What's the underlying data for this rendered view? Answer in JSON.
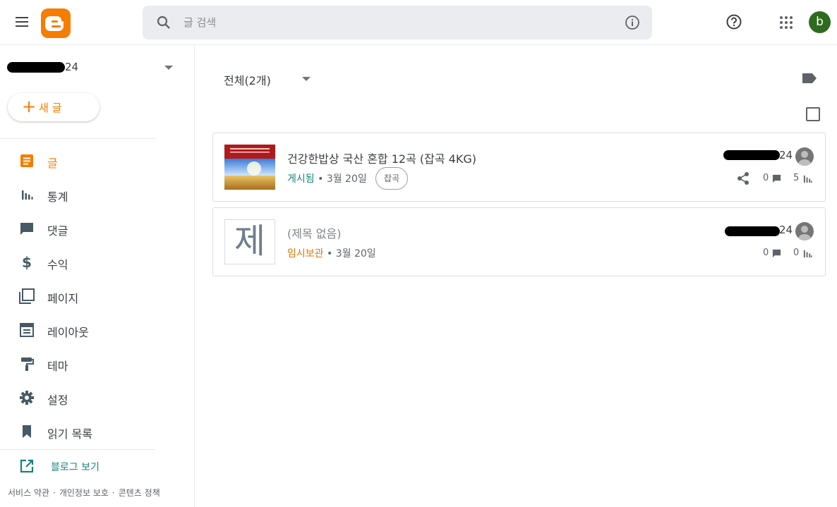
{
  "header": {
    "search_placeholder": "글 검색",
    "avatar_letter": "b"
  },
  "sidebar": {
    "blog_name_suffix": "24",
    "new_post_label": "새 글",
    "nav": [
      {
        "label": "글",
        "icon": "posts-icon",
        "active": true
      },
      {
        "label": "통계",
        "icon": "stats-icon",
        "active": false
      },
      {
        "label": "댓글",
        "icon": "comment-icon",
        "active": false
      },
      {
        "label": "수익",
        "icon": "dollar-icon",
        "active": false
      },
      {
        "label": "페이지",
        "icon": "pages-icon",
        "active": false
      },
      {
        "label": "레이아웃",
        "icon": "layout-icon",
        "active": false
      },
      {
        "label": "테마",
        "icon": "theme-icon",
        "active": false
      },
      {
        "label": "설정",
        "icon": "gear-icon",
        "active": false
      },
      {
        "label": "읽기 목록",
        "icon": "bookmark-icon",
        "active": false
      }
    ],
    "view_blog_label": "블로그 보기",
    "footer": [
      "서비스 약관",
      "개인정보 보호",
      "콘텐츠 정책"
    ]
  },
  "main": {
    "filter_label": "전체(2개)",
    "posts": [
      {
        "title": "건강한밥상 국산 혼합 12곡 (잡곡 4KG)",
        "status": "게시됨",
        "date": "3월 20일",
        "label_chip": "잡곡",
        "author_suffix": "24",
        "comments": "0",
        "views": "5"
      },
      {
        "title": "(제목 없음)",
        "status": "임시보관",
        "date": "3월 20일",
        "placeholder_char": "제",
        "author_suffix": "24",
        "comments": "0",
        "views": "0"
      }
    ]
  },
  "colors": {
    "accent": "#f57d00",
    "teal": "#15857a",
    "draft": "#e37400"
  }
}
